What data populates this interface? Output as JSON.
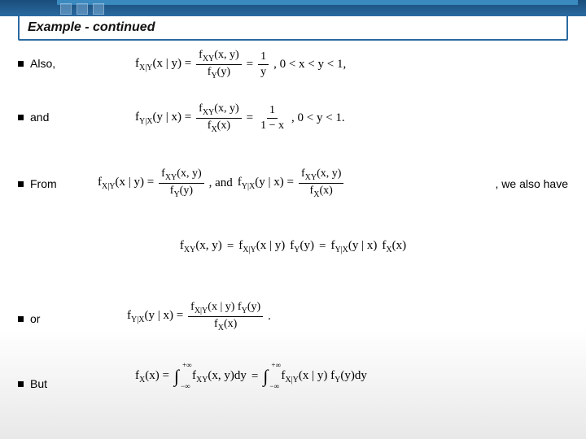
{
  "title": "Example - continued",
  "items": {
    "also": "Also,",
    "and": "and",
    "from": "From",
    "from_tail": ", we also have",
    "or": "or",
    "but": "But"
  },
  "eq1": {
    "lhs": "f",
    "lhs_sub": "X|Y",
    "lhs_args": "(x | y) =",
    "fnum": "f",
    "fnum_sub": "XY",
    "fnum_args": "(x, y)",
    "fden": "f",
    "fden_sub": "Y",
    "fden_args": "(y)",
    "mid": "=",
    "r_num": "1",
    "r_den": "y",
    "cond": ",   0 < x < y < 1,"
  },
  "eq2": {
    "lhs": "f",
    "lhs_sub": "Y|X",
    "lhs_args": "(y | x) =",
    "fnum": "f",
    "fnum_sub": "XY",
    "fnum_args": "(x, y)",
    "fden": "f",
    "fden_sub": "X",
    "fden_args": "(x)",
    "mid": "=",
    "r_num": "1",
    "r_den": "1 − x",
    "cond": ",   0 < y < 1."
  },
  "eq3": {
    "a_lhs": "f",
    "a_sub": "X|Y",
    "a_args": "(x | y) =",
    "a_num": "f",
    "a_num_sub": "XY",
    "a_num_args": "(x, y)",
    "a_den": "f",
    "a_den_sub": "Y",
    "a_den_args": "(y)",
    "conj": ", and ",
    "b_lhs": "f",
    "b_sub": "Y|X",
    "b_args": "(y | x) =",
    "b_num": "f",
    "b_num_sub": "XY",
    "b_num_args": "(x, y)",
    "b_den": "f",
    "b_den_sub": "X",
    "b_den_args": "(x)"
  },
  "eq4": {
    "lhs": "f",
    "lhs_sub": "XY",
    "lhs_args": "(x, y)",
    "eq": " = ",
    "t1": "f",
    "t1_sub": "X|Y",
    "t1_args": "(x | y)",
    "t2": "f",
    "t2_sub": "Y",
    "t2_args": "(y)",
    "eq2": " = ",
    "t3": "f",
    "t3_sub": "Y|X",
    "t3_args": "(y | x)",
    "t4": "f",
    "t4_sub": "X",
    "t4_args": "(x)"
  },
  "eq5": {
    "lhs": "f",
    "lhs_sub": "Y|X",
    "lhs_args": "(y | x) =",
    "num1": "f",
    "num1_sub": "X|Y",
    "num1_args": "(x | y) ",
    "num2": "f",
    "num2_sub": "Y",
    "num2_args": "(y)",
    "den": "f",
    "den_sub": "X",
    "den_args": "(x)",
    "dot": "."
  },
  "eq6": {
    "lhs": "f",
    "lhs_sub": "X",
    "lhs_args": "(x) = ",
    "lim_top": "+∞",
    "lim_bot": "−∞",
    "int1_body": "f",
    "int1_sub": "XY",
    "int1_args": "(x, y)dy",
    "eq": " = ",
    "int2_body": "f",
    "int2_sub": "X|Y",
    "int2_args": "(x | y)",
    "int2_b2": "f",
    "int2_b2_sub": "Y",
    "int2_b2_args": "(y)dy"
  }
}
